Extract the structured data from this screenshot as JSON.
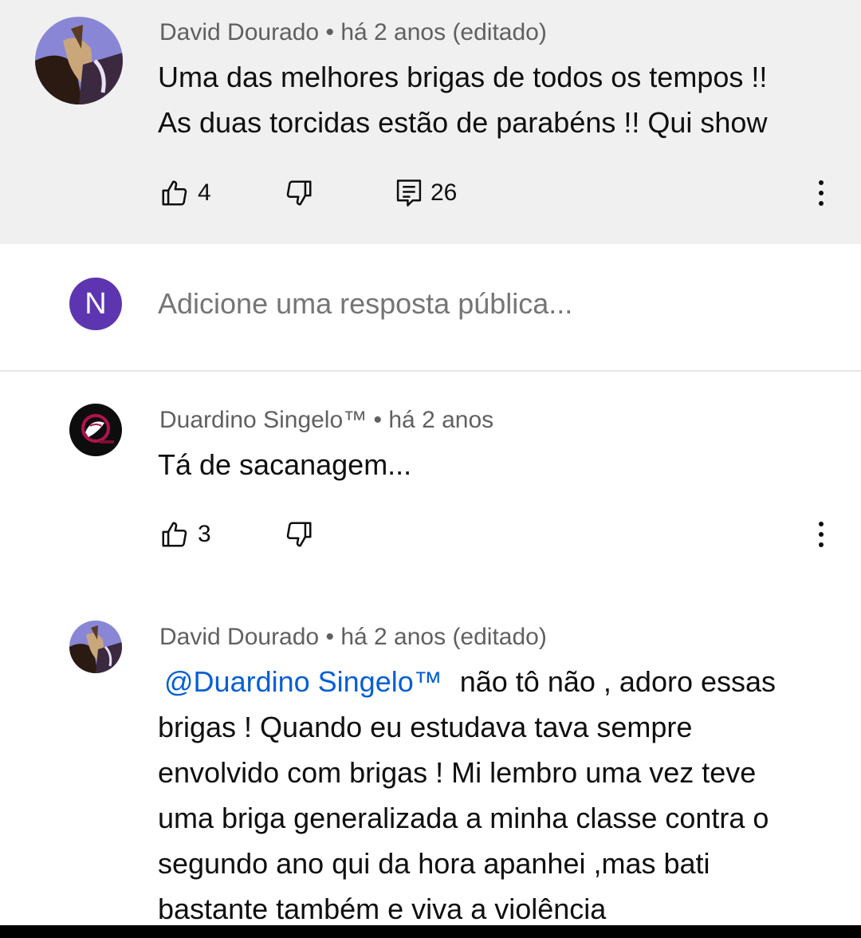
{
  "comments": [
    {
      "author": "David Dourado",
      "time": "há 2 anos (editado)",
      "text_lines": [
        "Uma das melhores brigas de todos os tempos !!",
        "As duas torcidas estão de parabéns !! Qui show"
      ],
      "likes": "4",
      "replies": "26"
    },
    {
      "author": "Duardino Singelo™",
      "time": "há 2 anos",
      "text_lines": [
        "Tá de sacanagem..."
      ],
      "likes": "3"
    },
    {
      "author": "David Dourado",
      "time": "há 2 anos (editado)",
      "mention": "@Duardino Singelo™",
      "text_first": "não tô não , adoro essas",
      "text_lines": [
        "brigas ! Quando eu estudava tava  sempre",
        "envolvido com brigas ! Mi lembro uma vez teve",
        "uma briga generalizada a minha classe contra o",
        "segundo ano  qui da hora apanhei ,mas bati",
        "bastante também e viva a violência"
      ]
    }
  ],
  "reply_box": {
    "avatar_letter": "N",
    "placeholder": "Adicione uma resposta pública...",
    "avatar_color": "#5e35b1"
  },
  "separator": "•",
  "colors": {
    "mention": "#065fd4",
    "meta": "#606060",
    "top_bg": "#f0f0f0"
  },
  "icons": [
    "thumbs-up-icon",
    "thumbs-down-icon",
    "reply-icon",
    "more-vert-icon"
  ]
}
